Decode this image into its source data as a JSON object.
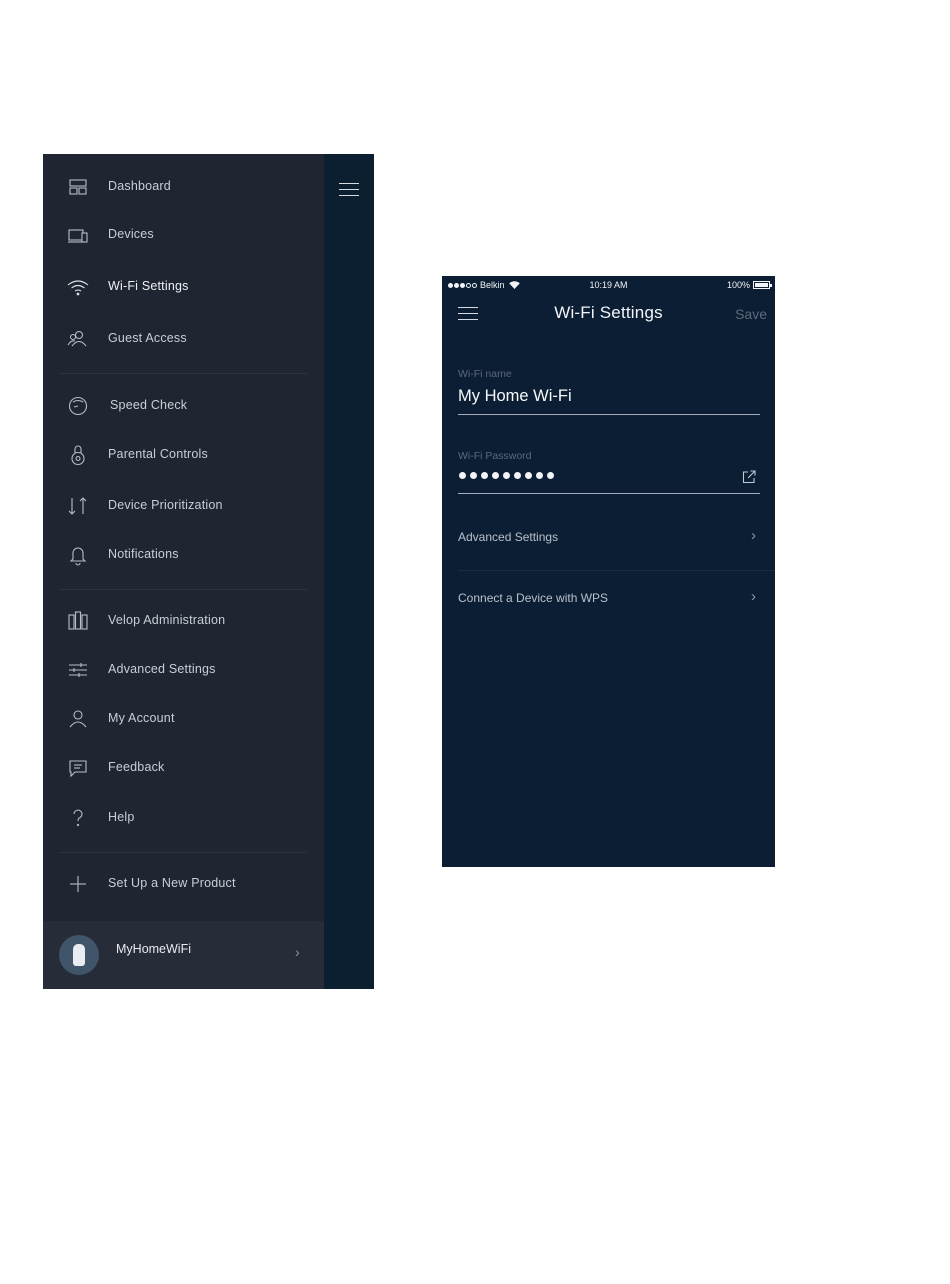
{
  "side_menu": {
    "items": [
      {
        "label": "Dashboard",
        "icon": "dashboard-icon"
      },
      {
        "label": "Devices",
        "icon": "devices-icon"
      },
      {
        "label": "Wi-Fi Settings",
        "icon": "wifi-icon",
        "active": true
      },
      {
        "label": "Guest Access",
        "icon": "guest-access-icon"
      },
      {
        "label": "Speed Check",
        "icon": "speed-check-icon"
      },
      {
        "label": "Parental Controls",
        "icon": "parental-controls-icon"
      },
      {
        "label": "Device Prioritization",
        "icon": "prioritization-arrows-icon"
      },
      {
        "label": "Notifications",
        "icon": "bell-icon"
      },
      {
        "label": "Velop Administration",
        "icon": "velop-nodes-icon"
      },
      {
        "label": "Advanced Settings",
        "icon": "sliders-icon"
      },
      {
        "label": "My Account",
        "icon": "user-icon"
      },
      {
        "label": "Feedback",
        "icon": "chat-bubble-icon"
      },
      {
        "label": "Help",
        "icon": "question-mark-icon"
      },
      {
        "label": "Set Up a New Product",
        "icon": "plus-icon"
      }
    ],
    "network": {
      "name": "MyHomeWiFi",
      "chevron": "›"
    }
  },
  "wifi_screen": {
    "status_bar": {
      "carrier": "Belkin",
      "time": "10:19 AM",
      "battery": "100%",
      "battery_level": 1.0
    },
    "title": "Wi-Fi Settings",
    "save_label": "Save",
    "wifi_name": {
      "label": "Wi-Fi name",
      "value": "My Home Wi-Fi"
    },
    "wifi_password": {
      "label": "Wi-Fi Password",
      "masked_length": 9
    },
    "rows": [
      {
        "label": "Advanced Settings",
        "chevron": "›"
      },
      {
        "label": "Connect a Device with WPS",
        "chevron": "›"
      }
    ]
  },
  "colors": {
    "menu_background": "#202631",
    "menu_strip": "#0b1f30",
    "screen_background": "#0c1e33",
    "save_disabled": "#5d6b7d"
  }
}
